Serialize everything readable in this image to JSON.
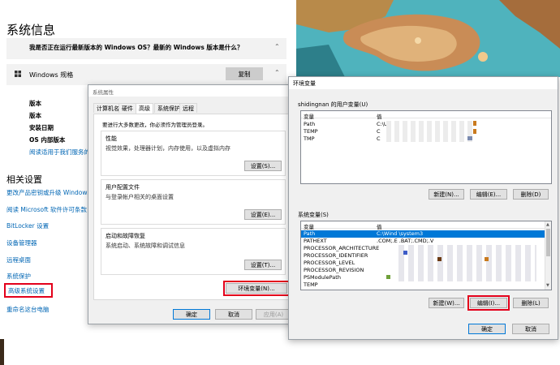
{
  "settings": {
    "title": "系统信息",
    "faq": "我是否正在运行最新版本的 Windows OS？最新的 Windows 版本是什么？",
    "spec_title": "Windows 规格",
    "copy_button": "复制",
    "spec_labels": [
      "版本",
      "版本",
      "安装日期",
      "OS 内部版本"
    ],
    "spec_link": "阅读适用于我们服务的",
    "related_title": "相关设置",
    "related_links": [
      "更改产品密钥或升级 Windows",
      "阅读 Microsoft 软件许可条款",
      "BitLocker 设置",
      "设备管理器",
      "远程桌面",
      "系统保护",
      "高级系统设置",
      "重命名这台电脑"
    ]
  },
  "sysprops": {
    "title": "系统属性",
    "tabs": [
      "计算机名",
      "硬件",
      "高级",
      "系统保护",
      "远程"
    ],
    "admin_note": "要进行大多数更改，你必须作为管理员登录。",
    "groups": [
      {
        "title": "性能",
        "desc": "视觉效果，处理器计划，内存使用，以及虚拟内存",
        "button": "设置(S)..."
      },
      {
        "title": "用户配置文件",
        "desc": "与登录帐户相关的桌面设置",
        "button": "设置(E)..."
      },
      {
        "title": "启动和故障恢复",
        "desc": "系统启动、系统故障和调试信息",
        "button": "设置(T)..."
      }
    ],
    "env_button": "环境变量(N)...",
    "ok": "确定",
    "cancel": "取消",
    "apply": "应用(A)"
  },
  "envvars": {
    "title": "环境变量",
    "user_section": "shidingnan 的用户变量(U)",
    "col_var": "变量",
    "col_val": "值",
    "user_rows": [
      {
        "name": "Path",
        "value": "C:\\U:"
      },
      {
        "name": "TEMP",
        "value": "C"
      },
      {
        "name": "TMP",
        "value": "C"
      }
    ],
    "user_buttons": [
      "新建(N)...",
      "编辑(E)...",
      "删除(D)"
    ],
    "sys_section": "系统变量(S)",
    "sys_rows": [
      {
        "name": "Path",
        "value": "C:\\Wind    \\system3"
      },
      {
        "name": "PATHEXT",
        "value": ".COM;.E    .BAT;.CMD;.V"
      },
      {
        "name": "PROCESSOR_ARCHITECTURE",
        "value": ""
      },
      {
        "name": "PROCESSOR_IDENTIFIER",
        "value": ""
      },
      {
        "name": "PROCESSOR_LEVEL",
        "value": ""
      },
      {
        "name": "PROCESSOR_REVISION",
        "value": ""
      },
      {
        "name": "PSModulePath",
        "value": ""
      },
      {
        "name": "TEMP",
        "value": ""
      }
    ],
    "sys_buttons": [
      "新建(W)...",
      "编辑(I)...",
      "删除(L)"
    ],
    "ok": "确定",
    "cancel": "取消"
  }
}
